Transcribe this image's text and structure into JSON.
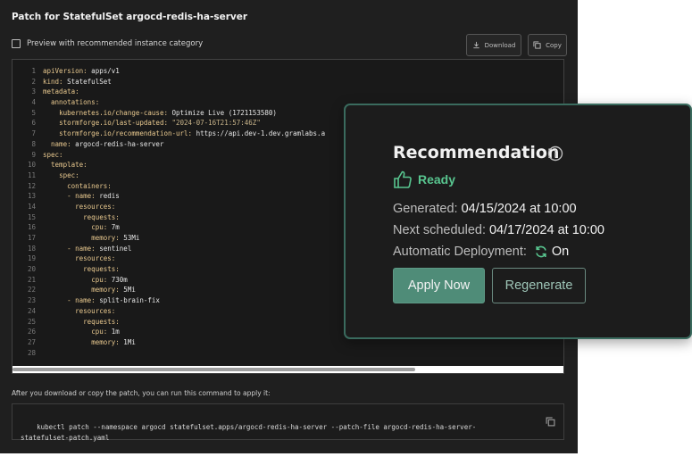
{
  "header": {
    "title": "Patch for StatefulSet argocd-redis-ha-server"
  },
  "preview": {
    "label": "Preview with recommended instance category",
    "checked": false
  },
  "toolbar": {
    "download_label": "Download",
    "copy_label": "Copy"
  },
  "code": {
    "lines": [
      {
        "n": "1",
        "indent": 0,
        "key": "apiVersion:",
        "val": " apps/v1"
      },
      {
        "n": "2",
        "indent": 0,
        "key": "kind:",
        "val": " StatefulSet"
      },
      {
        "n": "3",
        "indent": 0,
        "key": "metadata:",
        "val": ""
      },
      {
        "n": "4",
        "indent": 1,
        "key": "annotations:",
        "val": ""
      },
      {
        "n": "5",
        "indent": 2,
        "key": "kubernetes.io/change-cause:",
        "val": " Optimize Live (1721153580)"
      },
      {
        "n": "6",
        "indent": 2,
        "key": "stormforge.io/last-updated:",
        "val": " \"2024-07-16T21:57:46Z\""
      },
      {
        "n": "7",
        "indent": 2,
        "key": "stormforge.io/recommendation-url:",
        "val": " https://api.dev-1.dev.gramlabs.a"
      },
      {
        "n": "8",
        "indent": 1,
        "key": "name:",
        "val": " argocd-redis-ha-server"
      },
      {
        "n": "9",
        "indent": 0,
        "key": "spec:",
        "val": ""
      },
      {
        "n": "10",
        "indent": 1,
        "key": "template:",
        "val": ""
      },
      {
        "n": "11",
        "indent": 2,
        "key": "spec:",
        "val": ""
      },
      {
        "n": "12",
        "indent": 3,
        "key": "containers:",
        "val": ""
      },
      {
        "n": "13",
        "indent": 3,
        "key": "- name:",
        "val": " redis"
      },
      {
        "n": "14",
        "indent": 4,
        "key": "resources:",
        "val": ""
      },
      {
        "n": "15",
        "indent": 5,
        "key": "requests:",
        "val": ""
      },
      {
        "n": "16",
        "indent": 6,
        "key": "cpu:",
        "val": " 7m"
      },
      {
        "n": "17",
        "indent": 6,
        "key": "memory:",
        "val": " 53Mi"
      },
      {
        "n": "18",
        "indent": 3,
        "key": "- name:",
        "val": " sentinel"
      },
      {
        "n": "19",
        "indent": 4,
        "key": "resources:",
        "val": ""
      },
      {
        "n": "20",
        "indent": 5,
        "key": "requests:",
        "val": ""
      },
      {
        "n": "21",
        "indent": 6,
        "key": "cpu:",
        "val": " 730m"
      },
      {
        "n": "22",
        "indent": 6,
        "key": "memory:",
        "val": " 5Mi"
      },
      {
        "n": "23",
        "indent": 3,
        "key": "- name:",
        "val": " split-brain-fix"
      },
      {
        "n": "24",
        "indent": 4,
        "key": "resources:",
        "val": ""
      },
      {
        "n": "25",
        "indent": 5,
        "key": "requests:",
        "val": ""
      },
      {
        "n": "26",
        "indent": 6,
        "key": "cpu:",
        "val": " 1m"
      },
      {
        "n": "27",
        "indent": 6,
        "key": "memory:",
        "val": " 1Mi"
      },
      {
        "n": "28",
        "indent": 0,
        "key": "",
        "val": ""
      }
    ]
  },
  "instructions": {
    "text": "After you download or copy the patch, you can run this command to apply it:"
  },
  "command": {
    "text": "kubectl patch --namespace argocd statefulset.apps/argocd-redis-ha-server --patch-file argocd-redis-ha-server-\nstatefulset-patch.yaml"
  },
  "recommendation": {
    "title": "Recommendation",
    "status": "Ready",
    "generated_label": "Generated:",
    "generated_value": "04/15/2024 at 10:00",
    "next_label": "Next scheduled:",
    "next_value": "04/17/2024 at 10:00",
    "auto_label": "Automatic Deployment:",
    "auto_value": "On",
    "apply_label": "Apply Now",
    "regen_label": "Regenerate"
  },
  "colors": {
    "panel_bg": "#1f1f1f",
    "accent_green": "#4f8c78",
    "status_green": "#58c58f",
    "yaml_key": "#e9c98f"
  },
  "icons": {
    "download": "download-icon",
    "copy": "copy-icon",
    "info": "info-icon",
    "ready": "thumbs-up-icon",
    "auto": "sync-icon"
  }
}
